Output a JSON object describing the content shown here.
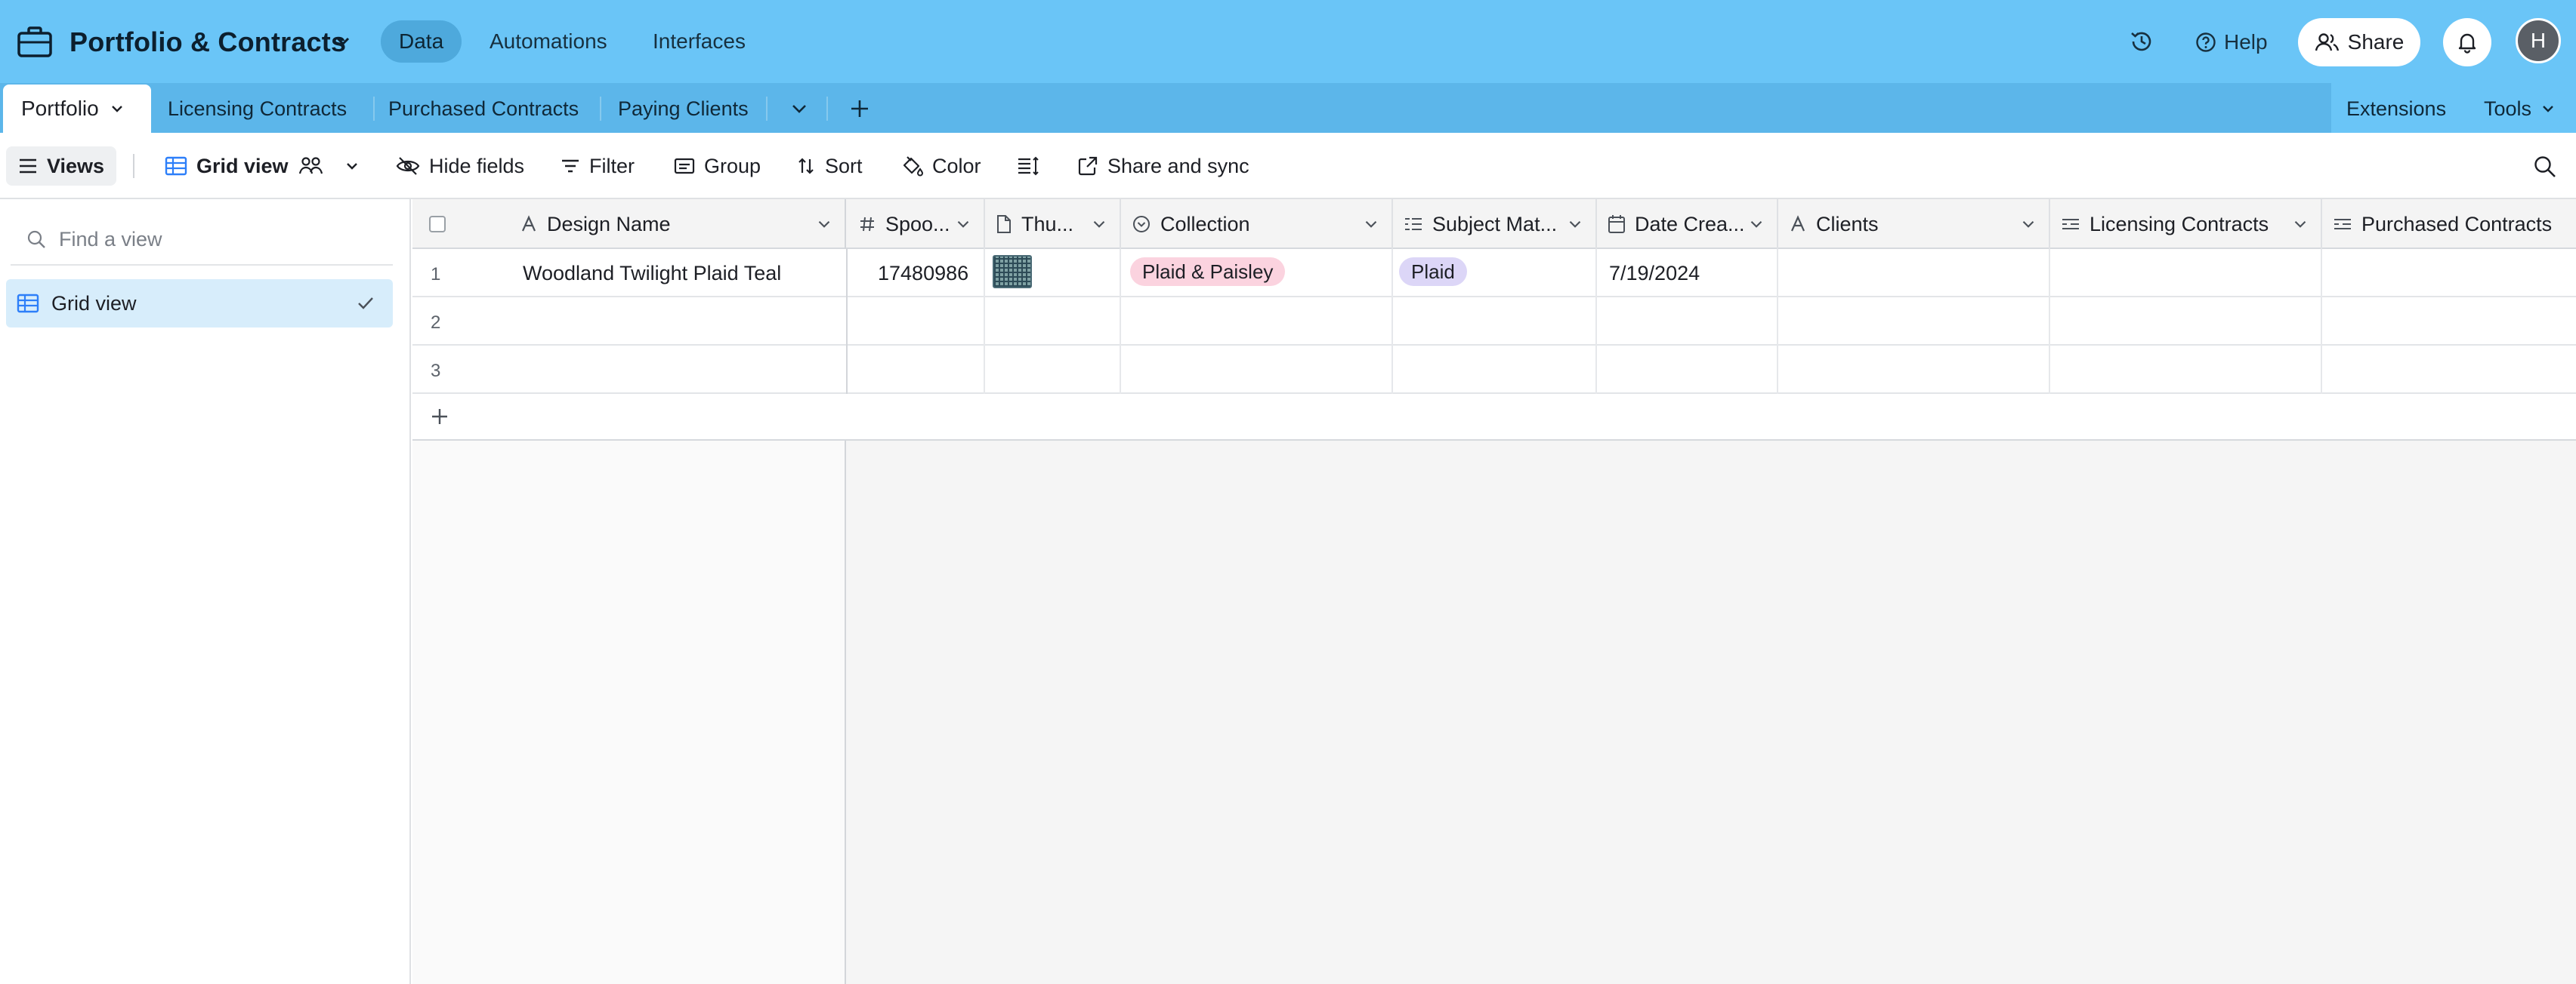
{
  "app": {
    "title": "Portfolio & Contracts",
    "nav": [
      "Data",
      "Automations",
      "Interfaces"
    ],
    "help_label": "Help",
    "share_label": "Share",
    "avatar_initial": "H",
    "colors": {
      "topbar": "#6ac5f7",
      "tabbar": "#5cb6ea",
      "active_nav": "#4ea9dc"
    }
  },
  "tables": {
    "active": "Portfolio",
    "others": [
      "Licensing Contracts",
      "Purchased Contracts",
      "Paying Clients"
    ],
    "extensions_label": "Extensions",
    "tools_label": "Tools"
  },
  "toolbar": {
    "views_label": "Views",
    "view_name": "Grid view",
    "hide_fields": "Hide fields",
    "filter": "Filter",
    "group": "Group",
    "sort": "Sort",
    "color": "Color",
    "share_sync": "Share and sync"
  },
  "sidebar": {
    "find_placeholder": "Find a view",
    "views": [
      {
        "name": "Grid view",
        "selected": true
      }
    ]
  },
  "grid": {
    "columns": [
      {
        "label": "Design Name",
        "icon": "text-icon"
      },
      {
        "label": "Spoo...",
        "icon": "number-icon"
      },
      {
        "label": "Thu...",
        "icon": "attachment-icon"
      },
      {
        "label": "Collection",
        "icon": "single-select-icon"
      },
      {
        "label": "Subject Mat...",
        "icon": "multi-select-icon"
      },
      {
        "label": "Date Crea...",
        "icon": "calendar-icon"
      },
      {
        "label": "Clients",
        "icon": "text-icon"
      },
      {
        "label": "Licensing Contracts",
        "icon": "link-icon"
      },
      {
        "label": "Purchased Contracts",
        "icon": "link-icon"
      }
    ],
    "rows": [
      {
        "num": "1",
        "design": "Woodland Twilight Plaid Teal",
        "spoon": "17480986",
        "collection": "Plaid & Paisley",
        "collection_color": "#fbd3df",
        "subject": "Plaid",
        "subject_color": "#dcd6f7",
        "date": "7/19/2024"
      },
      {
        "num": "2"
      },
      {
        "num": "3"
      }
    ]
  }
}
